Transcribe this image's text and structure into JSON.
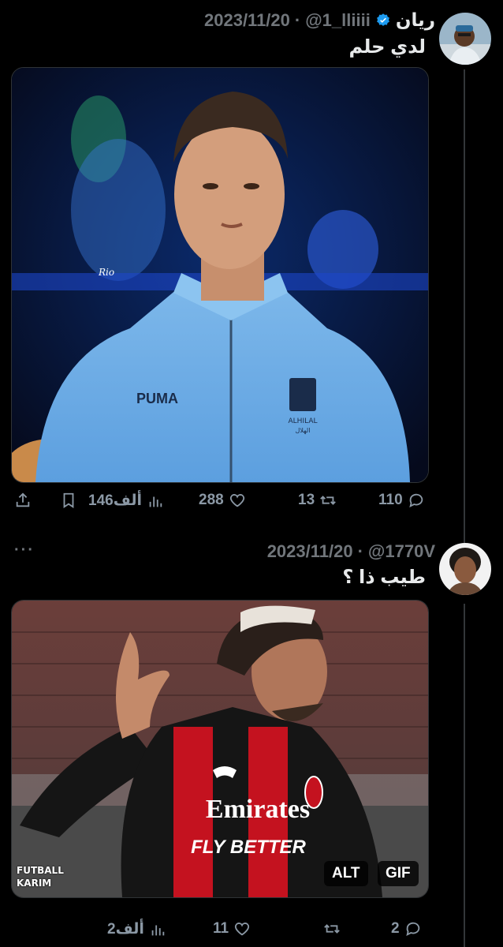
{
  "colors": {
    "background": "#000000",
    "text": "#e7e9ea",
    "muted": "#71767b",
    "verified": "#1d9bf0"
  },
  "tweet1": {
    "name": "ريان",
    "verified": true,
    "handle": "@1_lliiii",
    "separator": "·",
    "date": "2023/11/20",
    "text": "لدي حلم",
    "more_label": "···",
    "media": {
      "type": "photo",
      "signature": "Rio",
      "shirt_brand": "PUMA",
      "crest_text": "ALHILAL",
      "crest_text_ar": "الهلال"
    },
    "actions": {
      "replies": "110",
      "retweets": "13",
      "likes": "288",
      "views": "146ألف"
    }
  },
  "tweet2": {
    "handle": "@1770V",
    "separator": "·",
    "date": "2023/11/20",
    "text": "طيب ذا ؟",
    "more_label": "···",
    "media": {
      "type": "gif",
      "shirt_sponsor_line1": "Emirates",
      "shirt_sponsor_line2": "FLY BETTER",
      "watermark_line1": "FUTBALL",
      "watermark_line2": "KARIM",
      "alt_label": "ALT",
      "gif_label": "GIF"
    },
    "actions": {
      "replies": "2",
      "retweets": "",
      "likes": "11",
      "views": "2ألف"
    }
  }
}
